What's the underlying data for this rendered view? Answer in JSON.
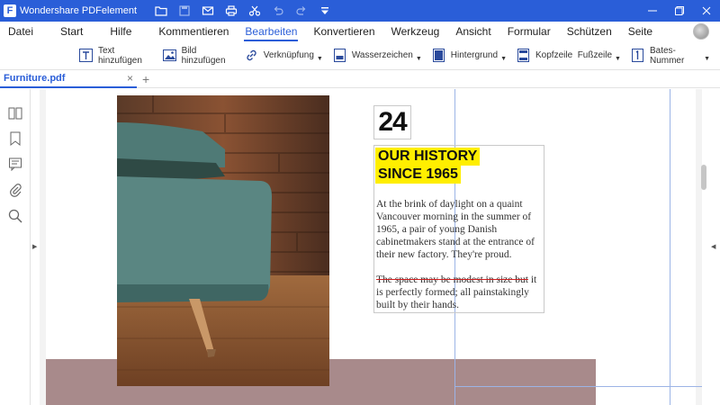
{
  "titlebar": {
    "app_name": "Wondershare PDFelement",
    "bg_color": "#2a5ed8",
    "quick_access": [
      "folder-icon",
      "save-icon",
      "mail-icon",
      "print-icon",
      "scissors-icon",
      "undo-icon",
      "redo-icon",
      "customize-icon"
    ],
    "window_buttons": [
      "minimize-icon",
      "maximize-icon",
      "close-icon"
    ]
  },
  "menu": {
    "items": [
      "Datei",
      "Start",
      "Hilfe",
      "Kommentieren",
      "Bearbeiten",
      "Konvertieren",
      "Werkzeug",
      "Ansicht",
      "Formular",
      "Schützen",
      "Seite"
    ],
    "active": "Bearbeiten"
  },
  "toolbar": {
    "items": [
      {
        "label": "Text hinzufügen",
        "icon": "text-box-icon"
      },
      {
        "label": "Bild hinzufügen",
        "icon": "image-icon"
      },
      {
        "label": "Verknüpfung",
        "icon": "link-icon"
      },
      {
        "label": "Wasserzeichen",
        "icon": "watermark-icon"
      },
      {
        "label": "Hintergrund",
        "icon": "background-icon"
      },
      {
        "label": "Kopfzeile  Fußzeile",
        "icon": "header-footer-icon"
      },
      {
        "label": "Bates-Nummer",
        "icon": "bates-number-icon"
      }
    ]
  },
  "tabs": {
    "file_tab": "Furniture.pdf",
    "close_glyph": "×",
    "add_glyph": "+"
  },
  "sidebar": {
    "icons": [
      "thumbnails-icon",
      "bookmark-icon",
      "comment-icon",
      "attachment-icon",
      "search-icon"
    ]
  },
  "document": {
    "page_number": "24",
    "heading_line1": "OUR HISTORY",
    "heading_line2": "SINCE 1965",
    "paragraph1": "At the brink of daylight on a quaint Vancouver morning in the summer of 1965, a pair of young Danish cabinetmakers stand at the entrance of their new factory. They're proud.",
    "paragraph2_struck": "The space may be modest in size but",
    "paragraph2_rest": " it is perfectly formed; all painstakingly built by their hands.",
    "highlight_color": "#ffee00",
    "strike_color": "#d02020",
    "bar_color": "#a88a8b"
  }
}
